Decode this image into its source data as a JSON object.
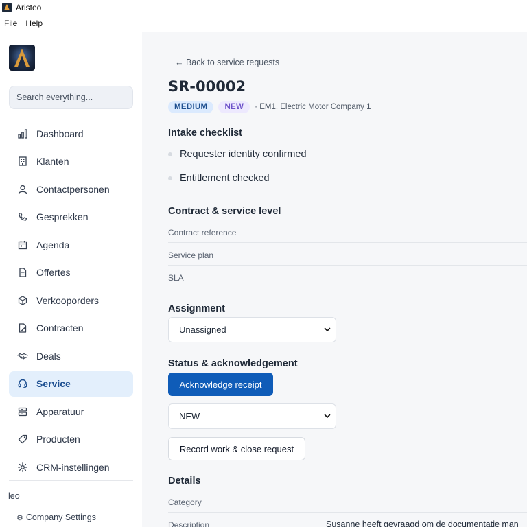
{
  "window": {
    "title": "Aristeo"
  },
  "menu": {
    "items": [
      "File",
      "Help"
    ]
  },
  "sidebar": {
    "search_placeholder": "Search everything...",
    "items": [
      {
        "label": "Dashboard",
        "icon": "bar-chart-icon"
      },
      {
        "label": "Klanten",
        "icon": "building-icon"
      },
      {
        "label": "Contactpersonen",
        "icon": "user-icon"
      },
      {
        "label": "Gesprekken",
        "icon": "phone-icon"
      },
      {
        "label": "Agenda",
        "icon": "calendar-icon"
      },
      {
        "label": "Offertes",
        "icon": "document-icon"
      },
      {
        "label": "Verkooporders",
        "icon": "box-icon"
      },
      {
        "label": "Contracten",
        "icon": "contract-icon"
      },
      {
        "label": "Deals",
        "icon": "handshake-icon"
      },
      {
        "label": "Service",
        "icon": "headset-icon",
        "active": true
      },
      {
        "label": "Apparatuur",
        "icon": "server-icon"
      },
      {
        "label": "Producten",
        "icon": "tag-icon"
      },
      {
        "label": "CRM-instellingen",
        "icon": "gear-icon"
      }
    ],
    "user": "leo",
    "company_settings": "Company Settings",
    "company_settings_icon": "⚙"
  },
  "main": {
    "back_link": "← Back to service requests",
    "title": "SR-00002",
    "priority_badge": "MEDIUM",
    "status_badge": "NEW",
    "company_ref": "· EM1, Electric Motor Company 1",
    "intake": {
      "heading": "Intake checklist",
      "items": [
        "Requester identity confirmed",
        "Entitlement checked"
      ]
    },
    "contract": {
      "heading": "Contract & service level",
      "rows": [
        "Contract reference",
        "Service plan",
        "SLA"
      ]
    },
    "assignment": {
      "heading": "Assignment",
      "value": "Unassigned"
    },
    "status": {
      "heading": "Status & acknowledgement",
      "ack_button": "Acknowledge receipt",
      "status_value": "NEW",
      "close_button": "Record work & close request"
    },
    "details": {
      "heading": "Details",
      "category_label": "Category",
      "description_label": "Description",
      "description_value": "Susanne heeft gevraagd om de documentatie man"
    }
  },
  "colors": {
    "primary": "#0f5cb8",
    "active_nav_bg": "#e3effc",
    "medium_badge_bg": "#dbeafe",
    "new_badge_bg": "#ede9fe"
  }
}
